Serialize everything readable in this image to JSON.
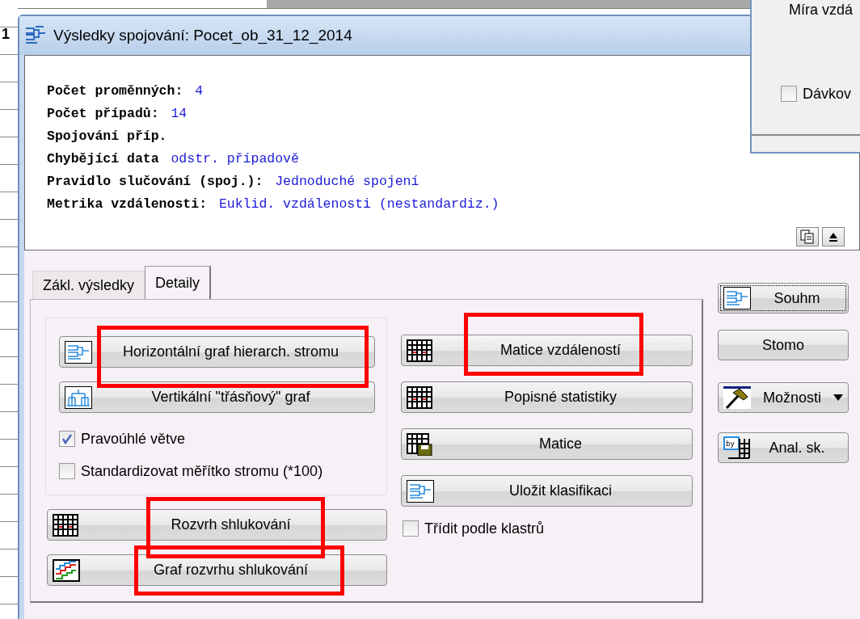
{
  "background": {
    "row_label": "1"
  },
  "back_dialog": {
    "label": "Míra vzdá",
    "checkbox": {
      "label": "Dávkov",
      "checked": false
    }
  },
  "window": {
    "title": "Výsledky spojování: Pocet_ob_31_12_2014"
  },
  "summary": [
    {
      "label": "Počet proměnných:",
      "value": "4"
    },
    {
      "label": "Počet případů:",
      "value": "14"
    },
    {
      "label": "Spojování příp."
    },
    {
      "label": "Chybějící data",
      "value": "odstr. případově"
    },
    {
      "label": "Pravidlo slučování (spoj.):",
      "value": "Jednoduché spojení"
    },
    {
      "label": "Metrika vzdálenosti:",
      "value": "Euklid. vzdálenosti (nestandardiz.)"
    }
  ],
  "tabs": [
    {
      "label": "Zákl. výsledky",
      "selected": false
    },
    {
      "label": "Detaily",
      "selected": true
    }
  ],
  "group_buttons": [
    {
      "label": "Horizontální graf hierarch. stromu",
      "kind": "tree",
      "highlighted": true
    },
    {
      "label": "Vertikální \"třásňový\" graf",
      "kind": "dendrogram",
      "highlighted": false
    }
  ],
  "group_checkboxes": [
    {
      "label": "Pravoúhlé větve",
      "checked": true
    },
    {
      "label": "Standardizovat měřítko stromu (*100)",
      "checked": false
    }
  ],
  "left_buttons": [
    {
      "label": "Rozvrh shlukování",
      "kind": "grid",
      "highlighted": true
    },
    {
      "label": "Graf rozvrhu shlukování",
      "kind": "steps",
      "highlighted": true
    }
  ],
  "right_buttons": [
    {
      "label": "Matice vzdáleností",
      "kind": "grid",
      "highlighted": true
    },
    {
      "label": "Popisné statistiky",
      "kind": "grid",
      "highlighted": false
    },
    {
      "label": "Matice",
      "kind": "gridsave",
      "highlighted": false
    },
    {
      "label": "Uložit klasifikaci",
      "kind": "tree",
      "highlighted": false
    }
  ],
  "right_checkbox": {
    "label": "Třídit podle klastrů",
    "checked": false
  },
  "side_buttons": [
    {
      "label": "Souhm",
      "kind": "tree",
      "focused": true,
      "dropdown": false
    },
    {
      "label": "Stomo",
      "kind": "plain",
      "focused": false,
      "dropdown": false
    },
    {
      "label": "Možnosti",
      "kind": "hammer",
      "focused": false,
      "dropdown": true
    },
    {
      "label": "Anal. sk.",
      "kind": "table",
      "icon_text": "by",
      "focused": false,
      "dropdown": false
    }
  ]
}
